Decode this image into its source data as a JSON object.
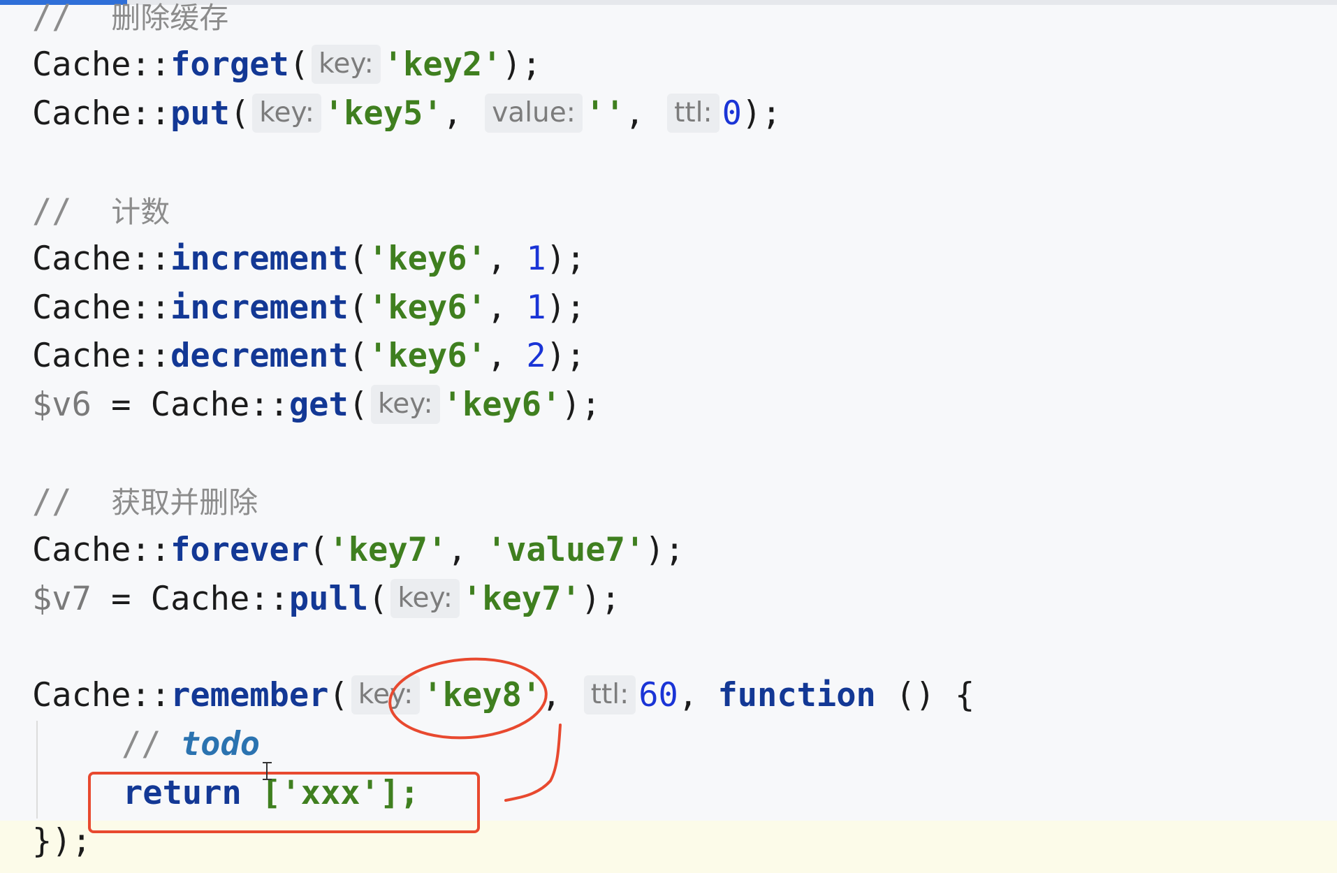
{
  "code_lines": [
    {
      "comment_prefix": "// ",
      "comment_text": "删除缓存"
    },
    {
      "cls": "Cache",
      "sep": "::",
      "method": "forget",
      "open": "(",
      "hint_key": "key:",
      "arg1": "'key2'",
      "close": ");"
    },
    {
      "cls": "Cache",
      "sep": "::",
      "method": "put",
      "open": "(",
      "hint_key": "key:",
      "arg1": "'key5'",
      "comma1": ", ",
      "hint_value": "value:",
      "arg2": "''",
      "comma2": ", ",
      "hint_ttl": "ttl:",
      "arg3": "0",
      "close": ");"
    },
    {
      "comment_prefix": "// ",
      "comment_text": "计数"
    },
    {
      "cls": "Cache",
      "sep": "::",
      "method": "increment",
      "open": "(",
      "arg1": "'key6'",
      "comma1": ", ",
      "arg2": "1",
      "close": ");"
    },
    {
      "cls": "Cache",
      "sep": "::",
      "method": "increment",
      "open": "(",
      "arg1": "'key6'",
      "comma1": ", ",
      "arg2": "1",
      "close": ");"
    },
    {
      "cls": "Cache",
      "sep": "::",
      "method": "decrement",
      "open": "(",
      "arg1": "'key6'",
      "comma1": ", ",
      "arg2": "2",
      "close": ");"
    },
    {
      "var": "$v6",
      "assign": " = ",
      "cls": "Cache",
      "sep": "::",
      "method": "get",
      "open": "(",
      "hint_key": "key:",
      "arg1": "'key6'",
      "close": ");"
    },
    {
      "comment_prefix": "// ",
      "comment_text": "获取并删除"
    },
    {
      "cls": "Cache",
      "sep": "::",
      "method": "forever",
      "open": "(",
      "arg1": "'key7'",
      "comma1": ", ",
      "arg2": "'value7'",
      "close": ");"
    },
    {
      "var": "$v7",
      "assign": " = ",
      "cls": "Cache",
      "sep": "::",
      "method": "pull",
      "open": "(",
      "hint_key": "key:",
      "arg1": "'key7'",
      "close": ");"
    },
    {
      "cls": "Cache",
      "sep": "::",
      "method": "remember",
      "open": "(",
      "hint_key": "key:",
      "arg1": "'key8'",
      "comma1": ", ",
      "hint_ttl": "ttl:",
      "arg2": "60",
      "comma2": ", ",
      "keyword": "function",
      "tail": " () {"
    },
    {
      "comment_prefix": "// ",
      "todo": "todo"
    },
    {
      "keyword": "return",
      "rest": " ['xxx'];"
    },
    {
      "close": "});"
    }
  ],
  "colors": {
    "background": "#f7f8fa",
    "annotation": "#e8492f",
    "tab_active": "#2f6fd8"
  }
}
